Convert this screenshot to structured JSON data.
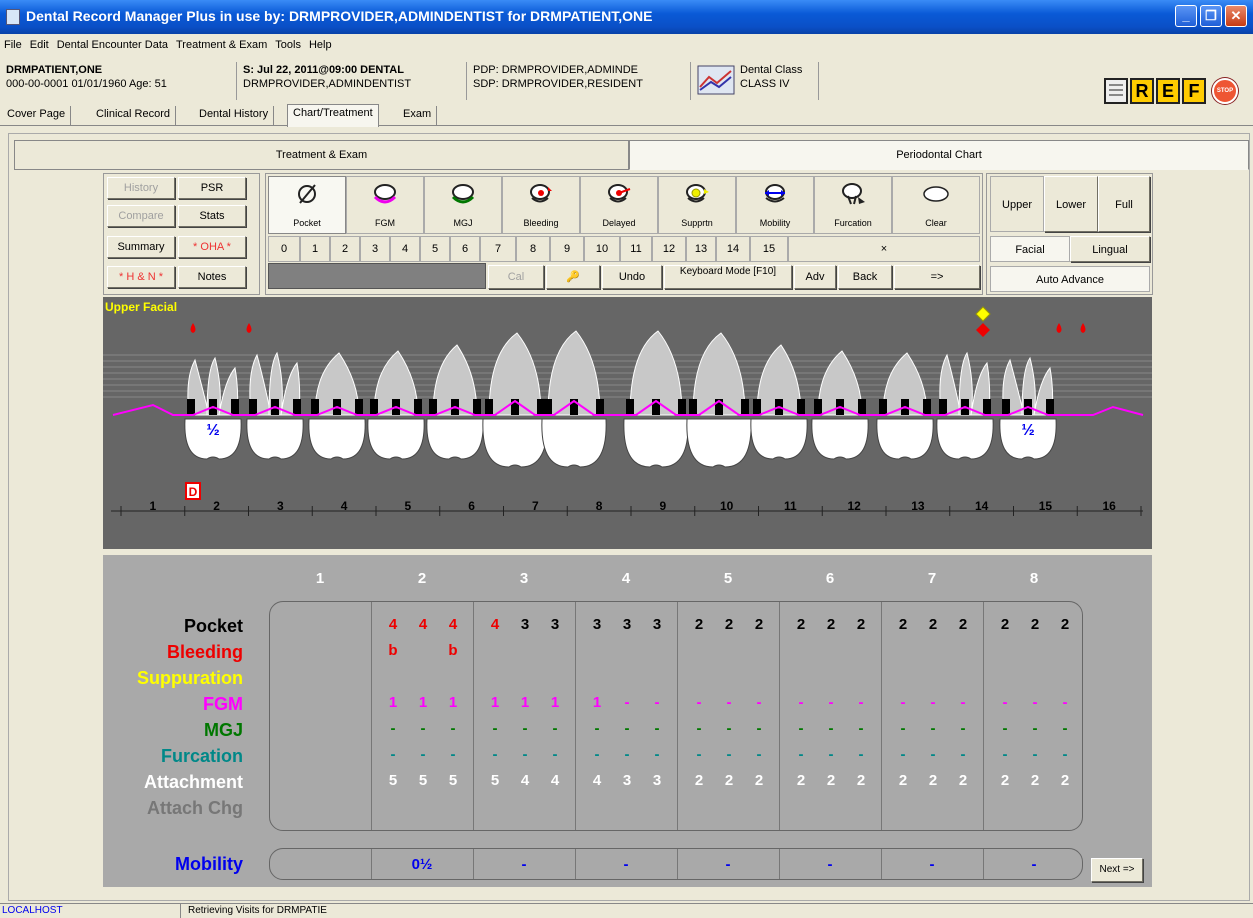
{
  "window": {
    "title": "Dental Record Manager Plus in use by: DRMPROVIDER,ADMINDENTIST for DRMPATIENT,ONE"
  },
  "menu": [
    "File",
    "Edit",
    "Dental Encounter Data",
    "Treatment & Exam",
    "Tools",
    "Help"
  ],
  "header": {
    "patient_name": "DRMPATIENT,ONE",
    "patient_info": "000-00-0001    01/01/1960 Age:  51",
    "visit": "S: Jul 22, 2011@09:00 DENTAL",
    "visit_provider": "DRMPROVIDER,ADMINDENTIST",
    "pdp": "PDP: DRMPROVIDER,ADMINDE",
    "sdp": "SDP: DRMPROVIDER,RESIDENT",
    "class_label": "Dental Class",
    "class_value": "CLASS IV",
    "tool_letters": [
      "R",
      "E",
      "F"
    ],
    "stop_label": "STOP"
  },
  "tabs": [
    "Cover Page",
    "Clinical Record",
    "Dental History",
    "Chart/Treatment",
    "Exam"
  ],
  "big_tabs": {
    "left": "Treatment & Exam",
    "right": "Periodontal Chart"
  },
  "left_buttons": {
    "history": "History",
    "psr": "PSR",
    "compare": "Compare",
    "stats": "Stats",
    "summary": "Summary",
    "oha": "* OHA *",
    "hn": "* H & N *",
    "notes": "Notes"
  },
  "tools": [
    "Pocket",
    "FGM",
    "MGJ",
    "Bleeding",
    "Delayed",
    "Supprtn",
    "Mobility",
    "Furcation",
    "Clear"
  ],
  "numpad": [
    "0",
    "1",
    "2",
    "3",
    "4",
    "5",
    "6",
    "7",
    "8",
    "9",
    "10",
    "11",
    "12",
    "13",
    "14",
    "15",
    "×"
  ],
  "action_buttons": {
    "cal": "Cal",
    "undo": "Undo",
    "keyboard_mode": "Keyboard Mode [F10]",
    "adv": "Adv",
    "back": "Back",
    "arrow": "=>"
  },
  "right_buttons": {
    "upper": "Upper",
    "lower": "Lower",
    "full": "Full",
    "facial": "Facial",
    "lingual": "Lingual",
    "auto_advance": "Auto Advance"
  },
  "chart": {
    "view_label": "Upper Facial",
    "half_label": "½",
    "d_marker": "D",
    "tooth_numbers": [
      "1",
      "2",
      "3",
      "4",
      "5",
      "6",
      "7",
      "8",
      "9",
      "10",
      "11",
      "12",
      "13",
      "14",
      "15",
      "16"
    ]
  },
  "grid": {
    "columns": [
      "1",
      "2",
      "3",
      "4",
      "5",
      "6",
      "7",
      "8"
    ],
    "row_labels": {
      "pocket": "Pocket",
      "bleeding": "Bleeding",
      "suppuration": "Suppuration",
      "fgm": "FGM",
      "mgj": "MGJ",
      "furcation": "Furcation",
      "attachment": "Attachment",
      "attach_chg": "Attach Chg",
      "mobility": "Mobility"
    },
    "pocket": [
      [
        "",
        "",
        ""
      ],
      [
        "4",
        "4",
        "4"
      ],
      [
        "4",
        "3",
        "3"
      ],
      [
        "3",
        "3",
        "3"
      ],
      [
        "2",
        "2",
        "2"
      ],
      [
        "2",
        "2",
        "2"
      ],
      [
        "2",
        "2",
        "2"
      ],
      [
        "2",
        "2",
        "2"
      ]
    ],
    "bleeding": [
      [
        "",
        "",
        ""
      ],
      [
        "b",
        "",
        "b"
      ],
      [
        "",
        "",
        ""
      ],
      [
        "",
        "",
        ""
      ],
      [
        "",
        "",
        ""
      ],
      [
        "",
        "",
        ""
      ],
      [
        "",
        "",
        ""
      ],
      [
        "",
        "",
        ""
      ]
    ],
    "fgm": [
      [
        "",
        "",
        ""
      ],
      [
        "1",
        "1",
        "1"
      ],
      [
        "1",
        "1",
        "1"
      ],
      [
        "1",
        "-",
        "-"
      ],
      [
        "-",
        "-",
        "-"
      ],
      [
        "-",
        "-",
        "-"
      ],
      [
        "-",
        "-",
        "-"
      ],
      [
        "-",
        "-",
        "-"
      ]
    ],
    "mgj": [
      [
        "",
        "",
        ""
      ],
      [
        "-",
        "-",
        "-"
      ],
      [
        "-",
        "-",
        "-"
      ],
      [
        "-",
        "-",
        "-"
      ],
      [
        "-",
        "-",
        "-"
      ],
      [
        "-",
        "-",
        "-"
      ],
      [
        "-",
        "-",
        "-"
      ],
      [
        "-",
        "-",
        "-"
      ]
    ],
    "furcation": [
      [
        "",
        "",
        ""
      ],
      [
        "-",
        "-",
        "-"
      ],
      [
        "-",
        "-",
        "-"
      ],
      [
        "-",
        "-",
        "-"
      ],
      [
        "-",
        "-",
        "-"
      ],
      [
        "-",
        "-",
        "-"
      ],
      [
        "-",
        "-",
        "-"
      ],
      [
        "-",
        "-",
        "-"
      ]
    ],
    "attachment": [
      [
        "",
        "",
        ""
      ],
      [
        "5",
        "5",
        "5"
      ],
      [
        "5",
        "4",
        "4"
      ],
      [
        "4",
        "3",
        "3"
      ],
      [
        "2",
        "2",
        "2"
      ],
      [
        "2",
        "2",
        "2"
      ],
      [
        "2",
        "2",
        "2"
      ],
      [
        "2",
        "2",
        "2"
      ]
    ],
    "mobility": [
      "",
      "0½",
      "-",
      "-",
      "-",
      "-",
      "-",
      "-"
    ],
    "next_button": "Next =>"
  },
  "colors": {
    "pocket_red": "#ff0000",
    "fgm_magenta": "#ff00ff",
    "mgj_green": "#007700",
    "furcation_teal": "#008080",
    "suppuration_yellow": "#ffff00",
    "mobility_blue": "#0000ee"
  },
  "status_bar": {
    "host": "LOCALHOST",
    "message": "Retrieving Visits for DRMPATIE"
  }
}
